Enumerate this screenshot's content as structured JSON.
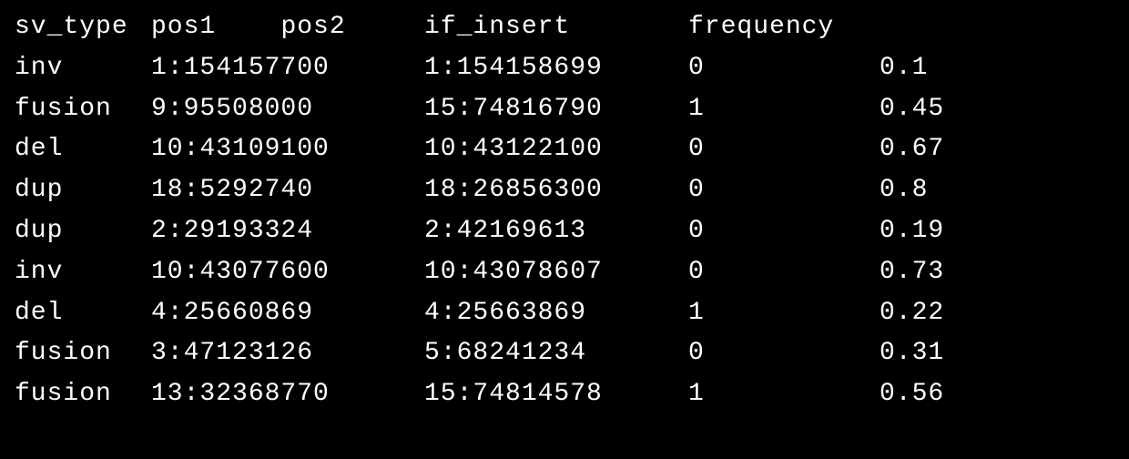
{
  "terminal": {
    "headers": {
      "sv_type": "sv_type",
      "pos1": "pos1",
      "pos2": "pos2",
      "if_insert": "if_insert",
      "frequency": "frequency"
    },
    "rows": [
      {
        "sv_type": "inv",
        "pos1": "1:154157700",
        "pos2": "1:154158699",
        "if_insert": "0",
        "frequency": "0.1"
      },
      {
        "sv_type": "fusion",
        "pos1": "9:95508000",
        "pos2": "15:74816790",
        "if_insert": "1",
        "frequency": "0.45"
      },
      {
        "sv_type": "del",
        "pos1": "10:43109100",
        "pos2": "10:43122100",
        "if_insert": "0",
        "frequency": "0.67"
      },
      {
        "sv_type": "dup",
        "pos1": "18:5292740",
        "pos2": "18:26856300",
        "if_insert": "0",
        "frequency": "0.8"
      },
      {
        "sv_type": "dup",
        "pos1": "2:29193324",
        "pos2": "2:42169613",
        "if_insert": "0",
        "frequency": "0.19"
      },
      {
        "sv_type": "inv",
        "pos1": "10:43077600",
        "pos2": "10:43078607",
        "if_insert": "0",
        "frequency": "0.73"
      },
      {
        "sv_type": "del",
        "pos1": "4:25660869",
        "pos2": "4:25663869",
        "if_insert": "1",
        "frequency": "0.22"
      },
      {
        "sv_type": "fusion",
        "pos1": "3:47123126",
        "pos2": "5:68241234",
        "if_insert": "0",
        "frequency": "0.31"
      },
      {
        "sv_type": "fusion",
        "pos1": "13:32368770",
        "pos2": "15:74814578",
        "if_insert": "1",
        "frequency": "0.56"
      }
    ]
  }
}
